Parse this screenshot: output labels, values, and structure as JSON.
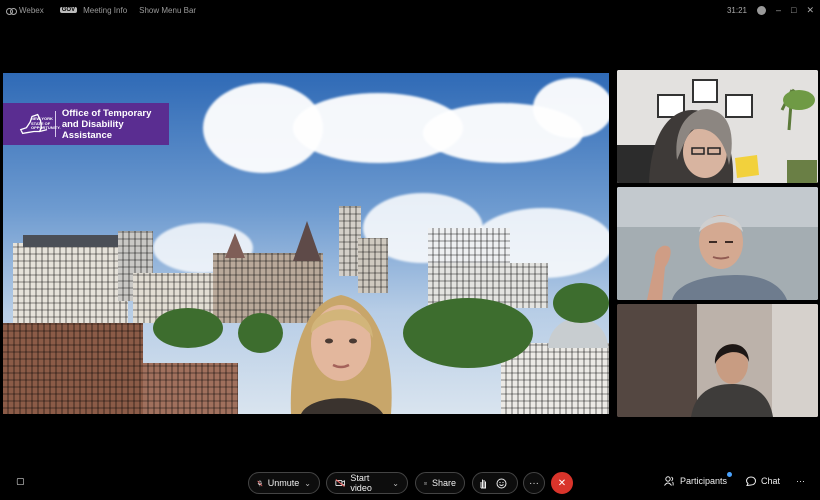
{
  "titlebar": {
    "app_name": "Webex",
    "gov_badge": "GOV",
    "meeting_info": "Meeting Info",
    "show_menu_bar": "Show Menu Bar",
    "timer": "31:21",
    "minimize": "–",
    "maximize": "□",
    "close": "✕"
  },
  "stage": {
    "logo": {
      "state_small": "NEW YORK\nSTATE OF\nOPPORTUNITY.",
      "line1": "Office of Temporary",
      "line2": "and Disability Assistance"
    }
  },
  "controls": {
    "chat_panel_icon": "▢",
    "unmute_label": "Unmute",
    "start_video_label": "Start video",
    "share_label": "Share",
    "more_label": "···",
    "leave_label": "✕",
    "participants_label": "Participants",
    "chat_label": "Chat",
    "overflow_label": "···"
  },
  "colors": {
    "brand_purple": "#5a2d91",
    "leave_red": "#d9342b",
    "notification_blue": "#4aa3ff"
  }
}
